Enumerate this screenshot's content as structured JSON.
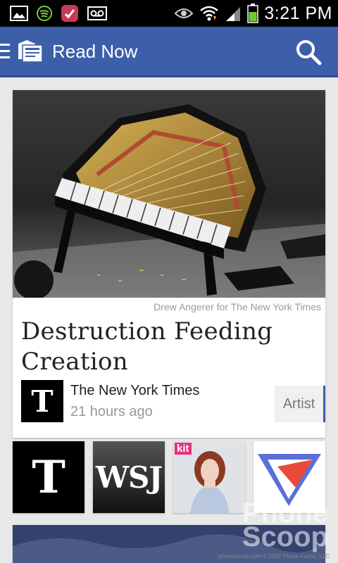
{
  "status_bar": {
    "time": "3:21 PM",
    "icons": [
      "gallery-icon",
      "spotify-icon",
      "app-notification-icon",
      "voicemail-icon",
      "eye-icon",
      "wifi-icon",
      "signal-icon",
      "battery-icon"
    ]
  },
  "action_bar": {
    "title": "Read Now",
    "icons": [
      "menu-icon",
      "newsstand-logo-icon",
      "search-icon"
    ],
    "color": "#3d5ea9"
  },
  "feature_article": {
    "photo_credit": "Drew Angerer for The New York Times",
    "headline": "Destruction Feeding Creation",
    "source_logo": "T",
    "source_name": "The New York Times",
    "time_ago": "21 hours ago",
    "topic_tag": "Artist"
  },
  "sources": [
    {
      "name": "The New York Times",
      "logo_text": "T"
    },
    {
      "name": "WSJ",
      "logo_text": "WSJ"
    },
    {
      "name": "Kit magazine",
      "logo_text": "kit"
    },
    {
      "name": "The Verge",
      "logo_text": ""
    }
  ],
  "watermark": {
    "line1": "Phone",
    "line2": "Scoop",
    "footer": "phonescoop.com © 2024 Phone Factor, LLC"
  }
}
